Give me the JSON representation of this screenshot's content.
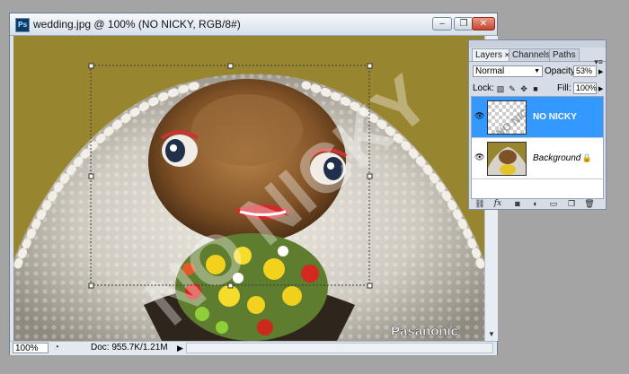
{
  "document": {
    "title": "wedding.jpg @ 100% (NO NICKY, RGB/8#)",
    "app_icon": "Ps",
    "window_buttons": {
      "minimize": "‒",
      "restore": "❐",
      "close": "✕"
    },
    "watermark": "NO NICKY",
    "brand_text": "Pasanonic"
  },
  "statusbar": {
    "zoom": "100%",
    "doc_info": "Doc: 955.7K/1.21M"
  },
  "layers_panel": {
    "tabs": [
      {
        "label": "Layers",
        "active": true
      },
      {
        "label": "Channels",
        "active": false
      },
      {
        "label": "Paths",
        "active": false
      }
    ],
    "blend_mode": "Normal",
    "opacity_label": "Opacity:",
    "opacity_value": "53%",
    "lock_label": "Lock:",
    "fill_label": "Fill:",
    "fill_value": "100%",
    "layers": [
      {
        "name": "NO NICKY",
        "selected": true,
        "visible": true
      },
      {
        "name": "Background",
        "selected": false,
        "visible": true,
        "locked": true
      }
    ],
    "footer_icons": [
      "link-icon",
      "fx-icon",
      "mask-icon",
      "adjustment-icon",
      "group-icon",
      "new-layer-icon",
      "trash-icon"
    ]
  },
  "colors": {
    "accent": "#3399ff",
    "backdrop": "#a4a4a4",
    "canvas_bg": "#98852f"
  }
}
